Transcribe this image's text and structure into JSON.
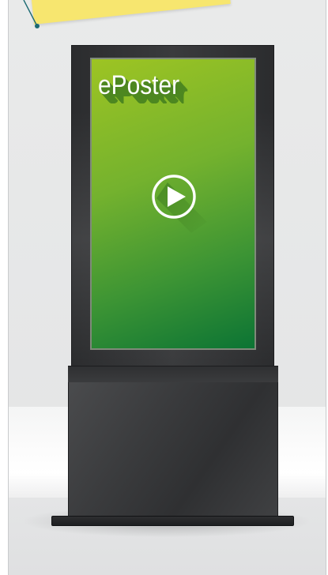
{
  "screen": {
    "title": "ePoster",
    "icon": "play-icon"
  },
  "colors": {
    "screen_top": "#9dc423",
    "screen_bottom": "#0c7434",
    "kiosk_body": "#2f3032",
    "note": "#f7e66f",
    "pointer": "#1c6a72"
  }
}
